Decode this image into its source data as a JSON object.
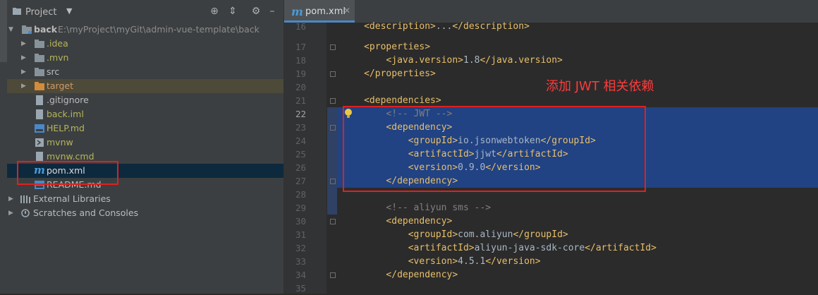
{
  "project_panel": {
    "title": "Project",
    "items": [
      {
        "label": "back",
        "path": "E:\\myProject\\myGit\\admin-vue-template\\back"
      },
      {
        "label": ".idea"
      },
      {
        "label": ".mvn"
      },
      {
        "label": "src"
      },
      {
        "label": "target"
      },
      {
        "label": ".gitignore"
      },
      {
        "label": "back.iml"
      },
      {
        "label": "HELP.md"
      },
      {
        "label": "mvnw"
      },
      {
        "label": "mvnw.cmd"
      },
      {
        "label": "pom.xml"
      },
      {
        "label": "README.md"
      },
      {
        "label": "External Libraries"
      },
      {
        "label": "Scratches and Consoles"
      }
    ]
  },
  "editor": {
    "tab_label": "pom.xml",
    "annotation": "添加 JWT 相关依赖",
    "lines": [
      {
        "num": "16",
        "code": "    <description>...</description>"
      },
      {
        "num": "17",
        "code": "    <properties>"
      },
      {
        "num": "18",
        "code": "        <java.version>1.8</java.version>"
      },
      {
        "num": "19",
        "code": "    </properties>"
      },
      {
        "num": "20",
        "code": ""
      },
      {
        "num": "21",
        "code": "    <dependencies>"
      },
      {
        "num": "22",
        "code": "        <!-- JWT -->"
      },
      {
        "num": "23",
        "code": "        <dependency>"
      },
      {
        "num": "24",
        "code": "            <groupId>io.jsonwebtoken</groupId>"
      },
      {
        "num": "25",
        "code": "            <artifactId>jjwt</artifactId>"
      },
      {
        "num": "26",
        "code": "            <version>0.9.0</version>"
      },
      {
        "num": "27",
        "code": "        </dependency>"
      },
      {
        "num": "28",
        "code": ""
      },
      {
        "num": "29",
        "code": "        <!-- aliyun sms -->"
      },
      {
        "num": "30",
        "code": "        <dependency>"
      },
      {
        "num": "31",
        "code": "            <groupId>com.aliyun</groupId>"
      },
      {
        "num": "32",
        "code": "            <artifactId>aliyun-java-sdk-core</artifactId>"
      },
      {
        "num": "33",
        "code": "            <version>4.5.1</version>"
      },
      {
        "num": "34",
        "code": "        </dependency>"
      },
      {
        "num": "35",
        "code": ""
      }
    ]
  },
  "colors": {
    "tag": "#e8bf6a",
    "text": "#a9b7c6",
    "comment": "#808080",
    "selection": "#214283",
    "annotation": "#ff3b3b"
  }
}
